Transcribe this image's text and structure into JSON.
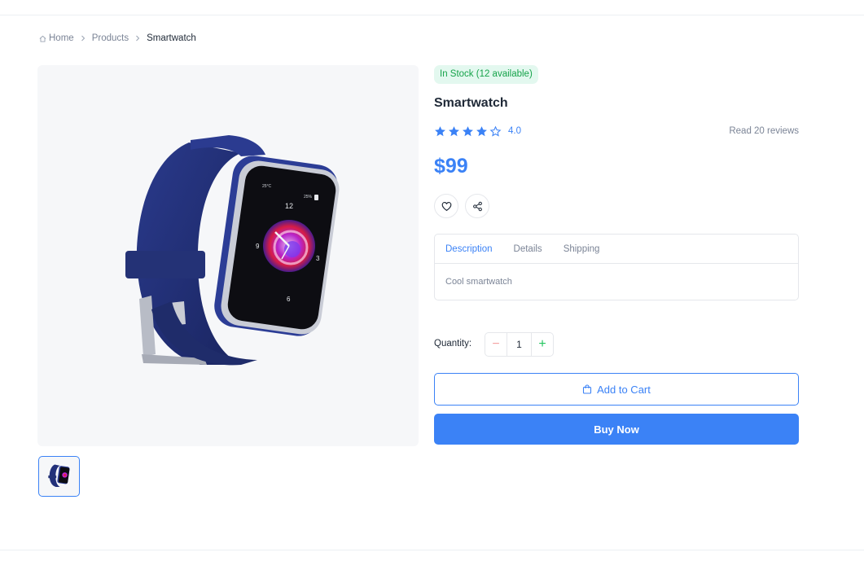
{
  "breadcrumb": {
    "home": "Home",
    "products": "Products",
    "current": "Smartwatch"
  },
  "product": {
    "stock_badge": "In Stock (12 available)",
    "title": "Smartwatch",
    "rating": 4.0,
    "rating_text": "4.0",
    "reviews_link": "Read 20 reviews",
    "price": "$99",
    "image_alt": "Smartwatch",
    "watch_face": {
      "temperature": "25°C",
      "battery": "25%",
      "numerals": [
        "12",
        "9",
        "3",
        "6"
      ]
    }
  },
  "tabs": [
    {
      "label": "Description",
      "active": true
    },
    {
      "label": "Details",
      "active": false
    },
    {
      "label": "Shipping",
      "active": false
    }
  ],
  "tab_content": "Cool smartwatch",
  "quantity": {
    "label": "Quantity:",
    "value": "1",
    "minus": "−",
    "plus": "+"
  },
  "buttons": {
    "add_to_cart": "Add to Cart",
    "buy_now": "Buy Now"
  },
  "icons": {
    "breadcrumb_home": "home-icon",
    "separator": "chevron-right-icon",
    "wishlist": "heart-icon",
    "share": "share-icon",
    "cart": "shopping-bag-icon",
    "star_filled": "star-filled-icon",
    "star_empty": "star-outline-icon"
  },
  "colors": {
    "accent": "#3b82f6",
    "stock_text": "#16a34a",
    "stock_bg": "#e3f8ef",
    "star": "#3b82f6",
    "watch_body": "#1f2e6e"
  }
}
